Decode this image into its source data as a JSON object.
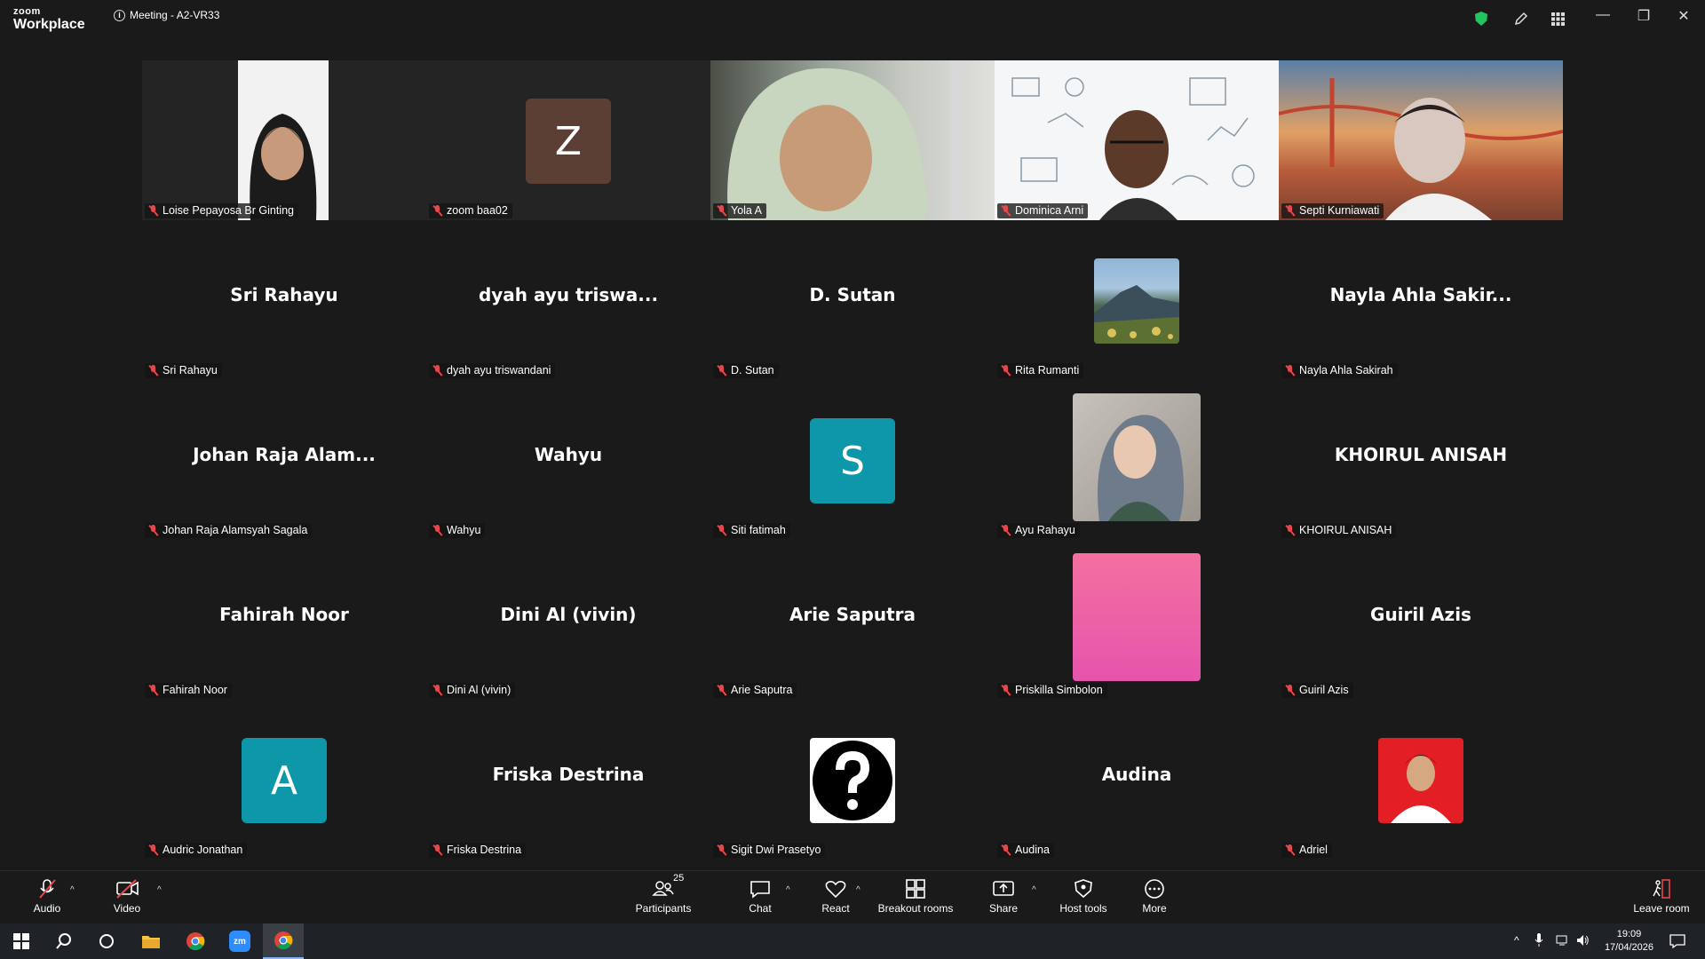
{
  "titlebar": {
    "logo_line1": "zoom",
    "logo_line2": "Workplace",
    "meeting_title": "Meeting - A2-VR33"
  },
  "colors": {
    "accent_green": "#22c55e",
    "muted_red": "#e5484d",
    "teal_avatar": "#0e97a8",
    "brown_avatar": "#5b3e34",
    "pink_avatar": "#ec5fa8"
  },
  "tiles": [
    {
      "name": "Loise Pepayosa Br Ginting",
      "display": "",
      "kind": "video"
    },
    {
      "name": "zoom baa02",
      "display": "",
      "kind": "letter",
      "letter": "Z"
    },
    {
      "name": "Yola A",
      "display": "",
      "kind": "video"
    },
    {
      "name": "Dominica Arni",
      "display": "",
      "kind": "video",
      "active": true
    },
    {
      "name": "Septi Kurniawati",
      "display": "",
      "kind": "video"
    },
    {
      "name": "Sri Rahayu",
      "display": "Sri Rahayu",
      "kind": "text"
    },
    {
      "name": "dyah ayu triswandani",
      "display": "dyah ayu triswa...",
      "kind": "text"
    },
    {
      "name": "D. Sutan",
      "display": "D. Sutan",
      "kind": "text"
    },
    {
      "name": "Rita Rumanti",
      "display": "",
      "kind": "photo-mountain"
    },
    {
      "name": "Nayla Ahla Sakirah",
      "display": "Nayla  Ahla  Sakir...",
      "kind": "text"
    },
    {
      "name": "Johan Raja Alamsyah Sagala",
      "display": "Johan  Raja  Alam...",
      "kind": "text"
    },
    {
      "name": "Wahyu",
      "display": "Wahyu",
      "kind": "text"
    },
    {
      "name": "Siti fatimah",
      "display": "",
      "kind": "letter",
      "letter": "S"
    },
    {
      "name": "Ayu Rahayu",
      "display": "",
      "kind": "photo-portrait"
    },
    {
      "name": "KHOIRUL ANISAH",
      "display": "KHOIRUL ANISAH",
      "kind": "text"
    },
    {
      "name": "Fahirah Noor",
      "display": "Fahirah Noor",
      "kind": "text"
    },
    {
      "name": "Dini Al (vivin)",
      "display": "Dini Al (vivin)",
      "kind": "text"
    },
    {
      "name": "Arie Saputra",
      "display": "Arie Saputra",
      "kind": "text"
    },
    {
      "name": "Priskilla Simbolon",
      "display": "",
      "kind": "pink"
    },
    {
      "name": "Guiril Azis",
      "display": "Guiril Azis",
      "kind": "text"
    },
    {
      "name": "Audric Jonathan",
      "display": "",
      "kind": "letter",
      "letter": "A"
    },
    {
      "name": "Friska Destrina",
      "display": "Friska Destrina",
      "kind": "text"
    },
    {
      "name": "Sigit Dwi Prasetyo",
      "display": "",
      "kind": "question"
    },
    {
      "name": "Audina",
      "display": "Audina",
      "kind": "text"
    },
    {
      "name": "Adriel",
      "display": "",
      "kind": "photo-red"
    }
  ],
  "toolbar": {
    "audio": "Audio",
    "video": "Video",
    "participants": "Participants",
    "participants_count": "25",
    "chat": "Chat",
    "react": "React",
    "breakout": "Breakout rooms",
    "share": "Share",
    "host_tools": "Host tools",
    "more": "More",
    "leave": "Leave room"
  },
  "taskbar": {
    "time": "19:09",
    "date": "17/04/2026"
  }
}
